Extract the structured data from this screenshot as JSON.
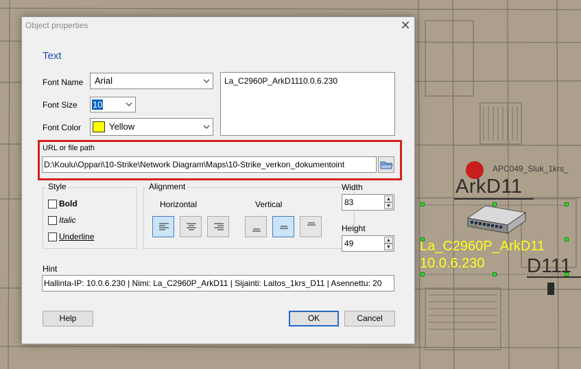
{
  "background": {
    "apc_label": "APC049_Sluk_1krs_",
    "area_label": "ArkD11",
    "room_label": "D111",
    "device_label_line1": "La_C2960P_ArkD11",
    "device_label_line2": "10.0.6.230"
  },
  "dialog": {
    "title": "Object properties",
    "close_glyph": "✕",
    "section_title": "Text",
    "font_name": {
      "label": "Font Name",
      "value": "Arial"
    },
    "font_size": {
      "label": "Font Size",
      "value": "10"
    },
    "font_color": {
      "label": "Font Color",
      "value": "Yellow",
      "swatch": "#ffff00"
    },
    "text_value": "La_C2960P_ArkD1110.0.6.230",
    "url": {
      "label": "URL or file path",
      "value": "D:\\Koulu\\Oppari\\10-Strike\\Network Diagram\\Maps\\10-Strike_verkon_dokumentoint",
      "highlight_color": "#d62020"
    },
    "style": {
      "title": "Style",
      "bold": "Bold",
      "italic": "Italic",
      "underline": "Underline"
    },
    "alignment": {
      "title": "Alignment",
      "horizontal": "Horizontal",
      "vertical": "Vertical",
      "horizontal_selected": "left",
      "vertical_selected": "middle"
    },
    "width": {
      "label": "Width",
      "value": "83"
    },
    "height": {
      "label": "Height",
      "value": "49"
    },
    "hint": {
      "label": "Hint",
      "value": "Hallinta-IP: 10.0.6.230 | Nimi: La_C2960P_ArkD11 | Sijainti: Laitos_1krs_D11 | Asennettu: 20"
    },
    "buttons": {
      "help": "Help",
      "ok": "OK",
      "cancel": "Cancel"
    }
  }
}
